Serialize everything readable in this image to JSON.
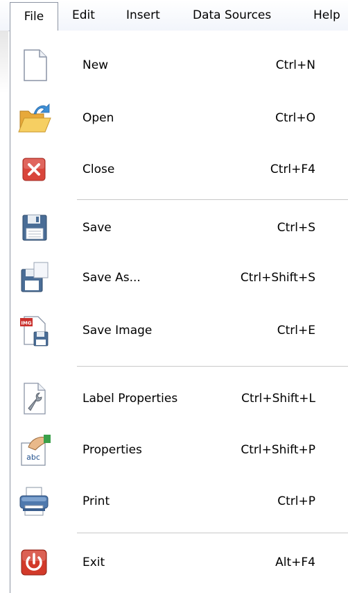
{
  "menubar": {
    "items": [
      "File",
      "Edit",
      "Insert",
      "Data Sources",
      "Help"
    ]
  },
  "file_menu": {
    "items": [
      {
        "label": "New",
        "shortcut": "Ctrl+N",
        "icon": "new-document-icon"
      },
      {
        "label": "Open",
        "shortcut": "Ctrl+O",
        "icon": "open-folder-icon"
      },
      {
        "label": "Close",
        "shortcut": "Ctrl+F4",
        "icon": "close-icon"
      },
      {
        "label": "Save",
        "shortcut": "Ctrl+S",
        "icon": "floppy-disk-icon"
      },
      {
        "label": "Save As...",
        "shortcut": "Ctrl+Shift+S",
        "icon": "save-as-icon"
      },
      {
        "label": "Save Image",
        "shortcut": "Ctrl+E",
        "icon": "save-image-icon"
      },
      {
        "label": "Label Properties",
        "shortcut": "Ctrl+Shift+L",
        "icon": "wrench-document-icon"
      },
      {
        "label": "Properties",
        "shortcut": "Ctrl+Shift+P",
        "icon": "properties-icon"
      },
      {
        "label": "Print",
        "shortcut": "Ctrl+P",
        "icon": "printer-icon"
      },
      {
        "label": "Exit",
        "shortcut": "Alt+F4",
        "icon": "power-icon"
      }
    ],
    "save_image_badge": "IMG",
    "properties_badge": "abc"
  },
  "colors": {
    "menu_border": "#8d95a3",
    "separator": "#c8c8c8",
    "close_red": "#d9453b",
    "exit_red": "#d23a2a",
    "disk_blue": "#4a6d96",
    "folder_yellow": "#f1c04e"
  }
}
